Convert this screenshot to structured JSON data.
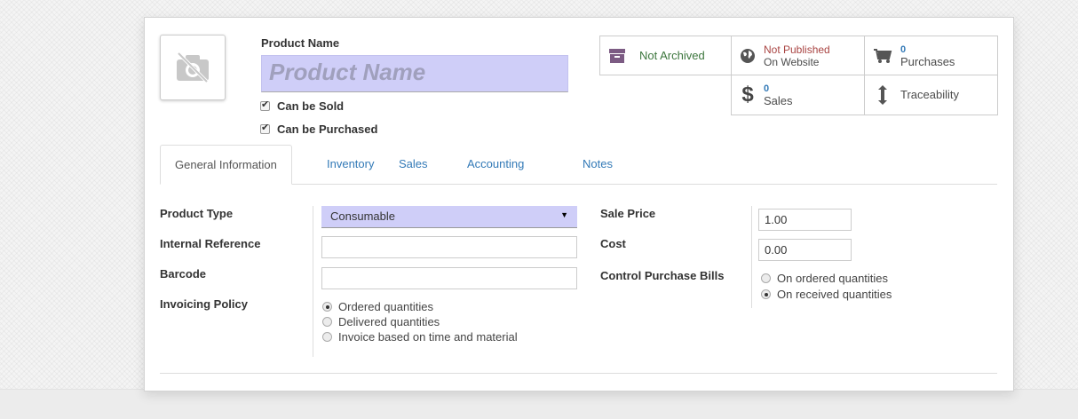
{
  "header": {
    "name_label": "Product Name",
    "name_placeholder": "Product Name",
    "can_be_sold": "Can be Sold",
    "can_be_purchased": "Can be Purchased"
  },
  "smart_buttons": {
    "archived": {
      "label": "Not Archived",
      "icon": "archive-icon"
    },
    "website": {
      "line1": "Not Published",
      "line2": "On Website",
      "icon": "globe-icon"
    },
    "purchases": {
      "count": "0",
      "label": "Purchases",
      "icon": "cart-icon"
    },
    "sales": {
      "count": "0",
      "label": "Sales",
      "icon": "dollar-icon"
    },
    "traceability": {
      "label": "Traceability",
      "icon": "arrows-vertical-icon"
    }
  },
  "tabs": [
    {
      "label": "General Information",
      "active": true
    },
    {
      "label": "Inventory"
    },
    {
      "label": "Sales"
    },
    {
      "label": "Accounting"
    },
    {
      "label": "Notes"
    }
  ],
  "left_fields": {
    "product_type": {
      "label": "Product Type",
      "value": "Consumable"
    },
    "internal_reference": {
      "label": "Internal Reference",
      "value": ""
    },
    "barcode": {
      "label": "Barcode",
      "value": ""
    },
    "invoicing_policy": {
      "label": "Invoicing Policy",
      "options": [
        "Ordered quantities",
        "Delivered quantities",
        "Invoice based on time and material"
      ],
      "selected": "Ordered quantities"
    }
  },
  "right_fields": {
    "sale_price": {
      "label": "Sale Price",
      "value": "1.00"
    },
    "cost": {
      "label": "Cost",
      "value": "0.00"
    },
    "control_purchase_bills": {
      "label": "Control Purchase Bills",
      "options": [
        "On ordered quantities",
        "On received quantities"
      ],
      "selected": "On received quantities"
    }
  },
  "colors": {
    "required_bg": "#cfcef8",
    "link": "#337ab7",
    "archive": "#7c5b83",
    "published": "#a94442"
  }
}
